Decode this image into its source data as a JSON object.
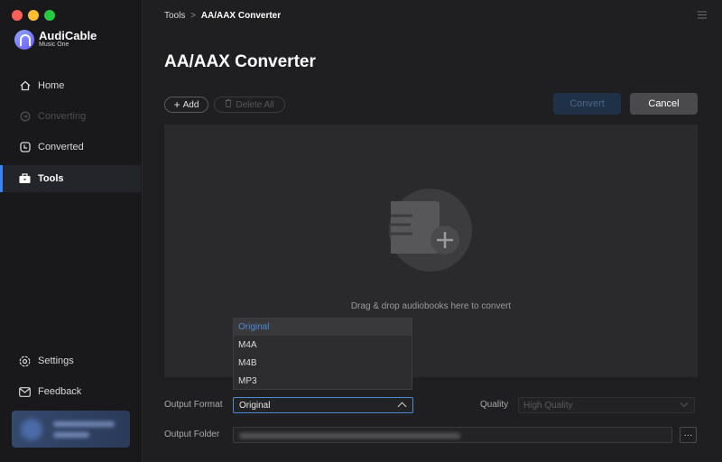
{
  "window": {
    "traffic_colors": [
      "#fe5f57",
      "#febc2e",
      "#28c840"
    ]
  },
  "brand": {
    "name": "AudiCable",
    "subtitle": "Music One",
    "accent": "#3b82f6"
  },
  "sidebar": {
    "items": [
      {
        "label": "Home",
        "icon": "home-icon",
        "state": "normal"
      },
      {
        "label": "Converting",
        "icon": "converting-icon",
        "state": "disabled"
      },
      {
        "label": "Converted",
        "icon": "clock-icon",
        "state": "normal"
      },
      {
        "label": "Tools",
        "icon": "toolbox-icon",
        "state": "active"
      }
    ],
    "bottom": [
      {
        "label": "Settings",
        "icon": "gear-icon"
      },
      {
        "label": "Feedback",
        "icon": "mail-icon"
      }
    ]
  },
  "header": {
    "breadcrumb_parent": "Tools",
    "breadcrumb_sep": ">",
    "breadcrumb_current": "AA/AAX Converter",
    "title": "AA/AAX Converter"
  },
  "toolbar": {
    "add_label": "Add",
    "delete_all_label": "Delete All",
    "convert_label": "Convert",
    "cancel_label": "Cancel"
  },
  "dropzone": {
    "text": "Drag & drop audiobooks here to convert"
  },
  "output": {
    "format_label": "Output Format",
    "format_value": "Original",
    "format_options": [
      "Original",
      "M4A",
      "M4B",
      "MP3"
    ],
    "quality_label": "Quality",
    "quality_value": "High Quality",
    "folder_label": "Output Folder",
    "browse_label": "···"
  }
}
